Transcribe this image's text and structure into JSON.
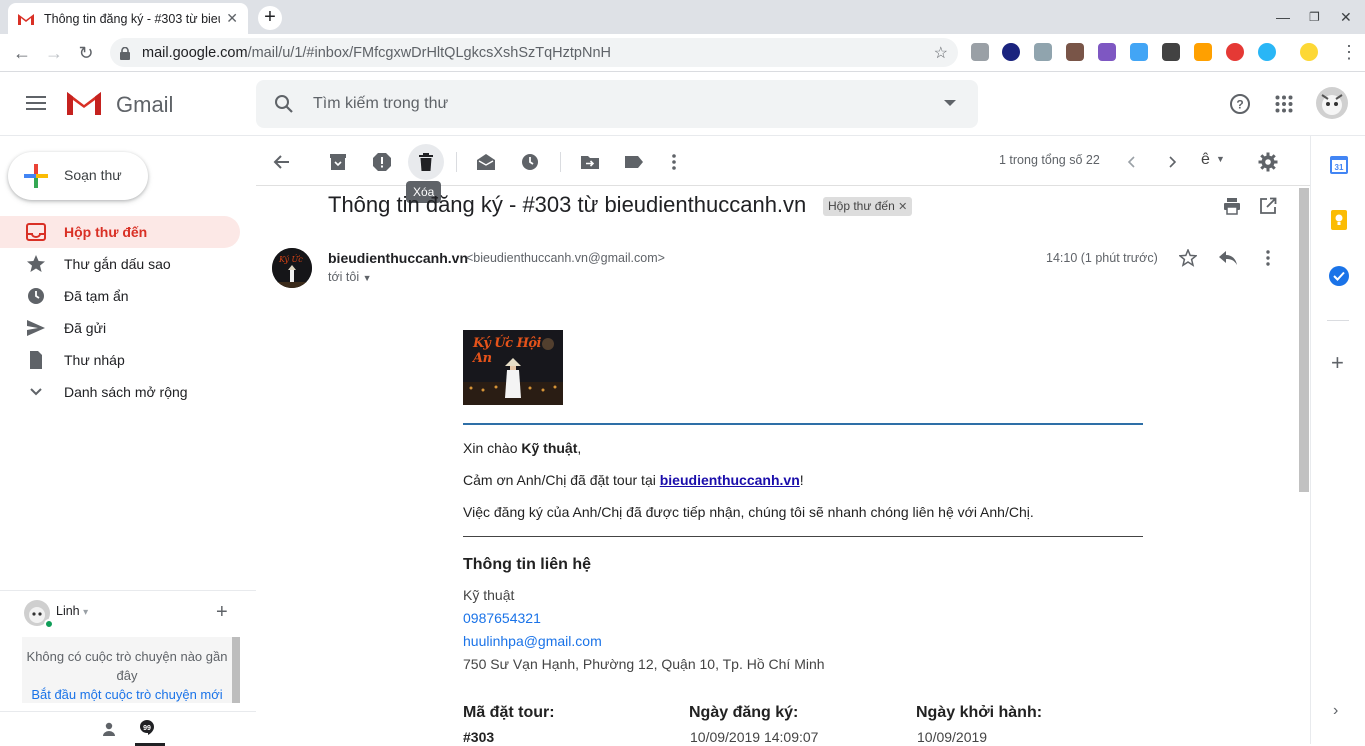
{
  "browser": {
    "tab_title": "Thông tin đăng ký - #303 từ bieu",
    "url_host": "mail.google.com",
    "url_path": "/mail/u/1/#inbox/FMfcgxwDrHltQLgkcsXshSzTqHztpNnH"
  },
  "gmail": {
    "logo_text": "Gmail",
    "search_placeholder": "Tìm kiếm trong thư"
  },
  "nav": {
    "compose": "Soạn thư",
    "items": [
      {
        "label": "Hộp thư đến",
        "icon": "inbox-icon",
        "active": true
      },
      {
        "label": "Thư gắn dấu sao",
        "icon": "star-icon",
        "active": false
      },
      {
        "label": "Đã tạm ẩn",
        "icon": "clock-icon",
        "active": false
      },
      {
        "label": "Đã gửi",
        "icon": "send-icon",
        "active": false
      },
      {
        "label": "Thư nháp",
        "icon": "draft-icon",
        "active": false
      },
      {
        "label": "Danh sách mở rộng",
        "icon": "chevron-down-icon",
        "active": false
      }
    ]
  },
  "hangouts": {
    "user": "Linh",
    "empty_line1": "Không có cuộc trò chuyện nào gần đây",
    "start_link": "Bắt đầu một cuộc trò chuyện mới"
  },
  "toolbar": {
    "delete_tooltip": "Xóa",
    "count": "1 trong tổng số 22"
  },
  "message": {
    "subject": "Thông tin đăng ký - #303 từ bieudienthuccanh.vn",
    "label": "Hộp thư đến",
    "sender_name": "bieudienthuccanh.vn",
    "sender_email": "<bieudienthuccanh.vn@gmail.com>",
    "to": "tới tôi",
    "time": "14:10 (1 phút trước)",
    "banner_text": "Ký Ức Hội An",
    "greeting_prefix": "Xin chào ",
    "greeting_name": "Kỹ thuật",
    "greeting_suffix": ",",
    "thanks_prefix": "Cảm ơn Anh/Chị đã đặt tour tại ",
    "thanks_link": "bieudienthuccanh.vn",
    "thanks_suffix": "!",
    "received": "Việc đăng ký của Anh/Chị đã được tiếp nhận, chúng tôi sẽ nhanh chóng liên hệ với Anh/Chị.",
    "contact_heading": "Thông tin liên hệ",
    "contact_name": "Kỹ thuật",
    "contact_phone": "0987654321",
    "contact_email": "huulinhpa@gmail.com",
    "contact_address": "750 Sư Vạn Hạnh, Phường 12, Quận 10, Tp. Hồ Chí Minh",
    "col1_label": "Mã đặt tour:",
    "col1_value": "#303",
    "col2_label": "Ngày đăng ký:",
    "col2_value": "10/09/2019 14:09:07",
    "col3_label": "Ngày khởi hành:",
    "col3_value": "10/09/2019"
  },
  "colors": {
    "active_nav_bg": "#fce8e6",
    "active_nav_fg": "#d93025",
    "link": "#1a73e8"
  }
}
